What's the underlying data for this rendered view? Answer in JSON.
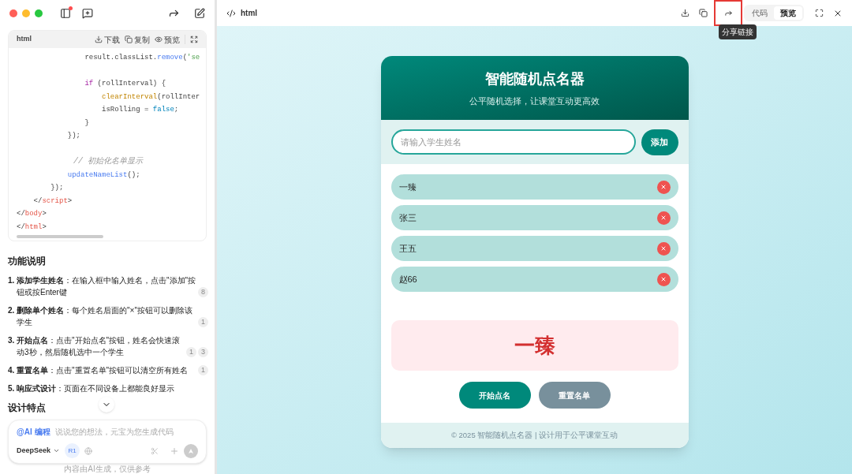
{
  "left": {
    "code_panel": {
      "language": "html",
      "actions": [
        {
          "kind": "download",
          "label": "下载"
        },
        {
          "kind": "copy",
          "label": "复制"
        },
        {
          "kind": "preview",
          "label": "预览"
        }
      ],
      "lines": [
        {
          "tokens": [
            {
              "kind": "plain",
              "text": "                result.classList."
            },
            {
              "kind": "method",
              "text": "remove"
            },
            {
              "kind": "plain",
              "text": "("
            },
            {
              "kind": "string",
              "text": "'se"
            }
          ]
        },
        {
          "kind": "blank"
        },
        {
          "tokens": [
            {
              "kind": "keyword",
              "text": "                if"
            },
            {
              "kind": "plain",
              "text": " (rollInterval) {"
            }
          ]
        },
        {
          "tokens": [
            {
              "kind": "fn",
              "text": "                    clearInterval"
            },
            {
              "kind": "plain",
              "text": "(rollInter"
            }
          ]
        },
        {
          "tokens": [
            {
              "kind": "plain",
              "text": "                    isRolling = "
            },
            {
              "kind": "bool",
              "text": "false"
            },
            {
              "kind": "plain",
              "text": ";"
            }
          ]
        },
        {
          "tokens": [
            {
              "kind": "plain",
              "text": "                }"
            }
          ]
        },
        {
          "tokens": [
            {
              "kind": "plain",
              "text": "            });"
            }
          ]
        },
        {
          "kind": "blank"
        },
        {
          "tokens": [
            {
              "kind": "comment",
              "text": "            // 初始化名单显示"
            }
          ]
        },
        {
          "tokens": [
            {
              "kind": "method",
              "text": "            updateNameList"
            },
            {
              "kind": "plain",
              "text": "();"
            }
          ]
        },
        {
          "tokens": [
            {
              "kind": "plain",
              "text": "        });"
            }
          ]
        },
        {
          "tokens": [
            {
              "kind": "plain",
              "text": "    </"
            },
            {
              "kind": "tag",
              "text": "script"
            },
            {
              "kind": "plain",
              "text": ">"
            }
          ]
        },
        {
          "tokens": [
            {
              "kind": "plain",
              "text": "</"
            },
            {
              "kind": "tag",
              "text": "body"
            },
            {
              "kind": "plain",
              "text": ">"
            }
          ]
        },
        {
          "tokens": [
            {
              "kind": "plain",
              "text": "</"
            },
            {
              "kind": "tag",
              "text": "html"
            },
            {
              "kind": "plain",
              "text": ">"
            }
          ]
        }
      ]
    },
    "heading": "功能说明",
    "features": [
      {
        "number": "1.",
        "text": "**添加学生姓名**：在输入框中输入姓名，点击\"添加\"按钮或按Enter键",
        "refs": [
          "8"
        ]
      },
      {
        "number": "2.",
        "text": "**删除单个姓名**：每个姓名后面的\"×\"按钮可以删除该学生",
        "refs": [
          "1"
        ]
      },
      {
        "number": "3.",
        "text": "**开始点名**：点击\"开始点名\"按钮，姓名会快速滚动3秒，然后随机选中一个学生",
        "refs": [
          "1",
          "3"
        ]
      },
      {
        "number": "4.",
        "text": "**重置名单**：点击\"重置名单\"按钮可以清空所有姓名",
        "refs": [
          "1"
        ]
      },
      {
        "number": "5.",
        "text": "**响应式设计**：页面在不同设备上都能良好显示"
      }
    ],
    "next_heading": "设计特点",
    "composer": {
      "mention": "@AI 编程",
      "placeholder": "说说您的想法，元宝为您生成代码",
      "model": "DeepSeek",
      "r1": {
        "label": "R1",
        "selected": true
      }
    },
    "disclaimer": "内容由AI生成，仅供参考"
  },
  "right": {
    "title": "html",
    "share_highlighted": true,
    "tooltip": "分享链接",
    "view_tabs": [
      {
        "label": "代码",
        "selected": false
      },
      {
        "label": "预览",
        "selected": true
      }
    ],
    "app": {
      "title": "智能随机点名器",
      "subtitle": "公平随机选择，让课堂互动更高效",
      "input_placeholder": "请输入学生姓名",
      "add_button": "添加",
      "names": [
        "一臻",
        "张三",
        "王五",
        "赵66"
      ],
      "result": "一臻",
      "buttons": [
        {
          "kind": "primary",
          "label": "开始点名"
        },
        {
          "kind": "secondary",
          "label": "重置名单"
        }
      ],
      "footer": "© 2025 智能随机点名器 | 设计用于公平课堂互动"
    }
  }
}
